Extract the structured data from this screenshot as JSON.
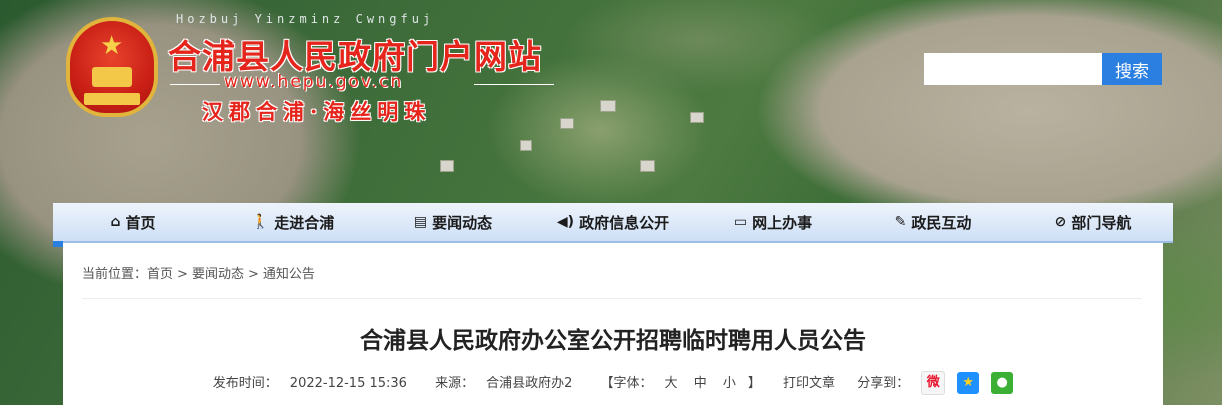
{
  "header": {
    "pinyin": "Hozbuj Yinzminz Cwngfuj",
    "site_title": "合浦县人民政府门户网站",
    "site_url": "www.hepu.gov.cn",
    "slogan": "汉郡合浦·海丝明珠"
  },
  "search": {
    "placeholder": "",
    "value": "",
    "button_label": "搜索"
  },
  "nav": {
    "items": [
      {
        "label": "首页",
        "icon": "home-icon"
      },
      {
        "label": "走进合浦",
        "icon": "walk-icon"
      },
      {
        "label": "要闻动态",
        "icon": "news-icon"
      },
      {
        "label": "政府信息公开",
        "icon": "speaker-icon"
      },
      {
        "label": "网上办事",
        "icon": "monitor-icon"
      },
      {
        "label": "政民互动",
        "icon": "handshake-icon"
      },
      {
        "label": "部门导航",
        "icon": "compass-icon"
      }
    ]
  },
  "breadcrumb": {
    "prefix": "当前位置：",
    "items": [
      "首页",
      "要闻动态",
      "通知公告"
    ],
    "separator": ">"
  },
  "article": {
    "title": "合浦县人民政府办公室公开招聘临时聘用人员公告",
    "publish_label": "发布时间：",
    "publish_time": "2022-12-15 15:36",
    "source_label": "来源：",
    "source": "合浦县政府办2",
    "font_label": "【字体：",
    "font_large": "大",
    "font_medium": "中",
    "font_small": "小",
    "font_close": "】",
    "print_label": "打印文章",
    "share_label": "分享到："
  },
  "colors": {
    "brand_red": "#e5241b",
    "search_blue": "#2a7fe0",
    "nav_bg": "#cddff6"
  }
}
